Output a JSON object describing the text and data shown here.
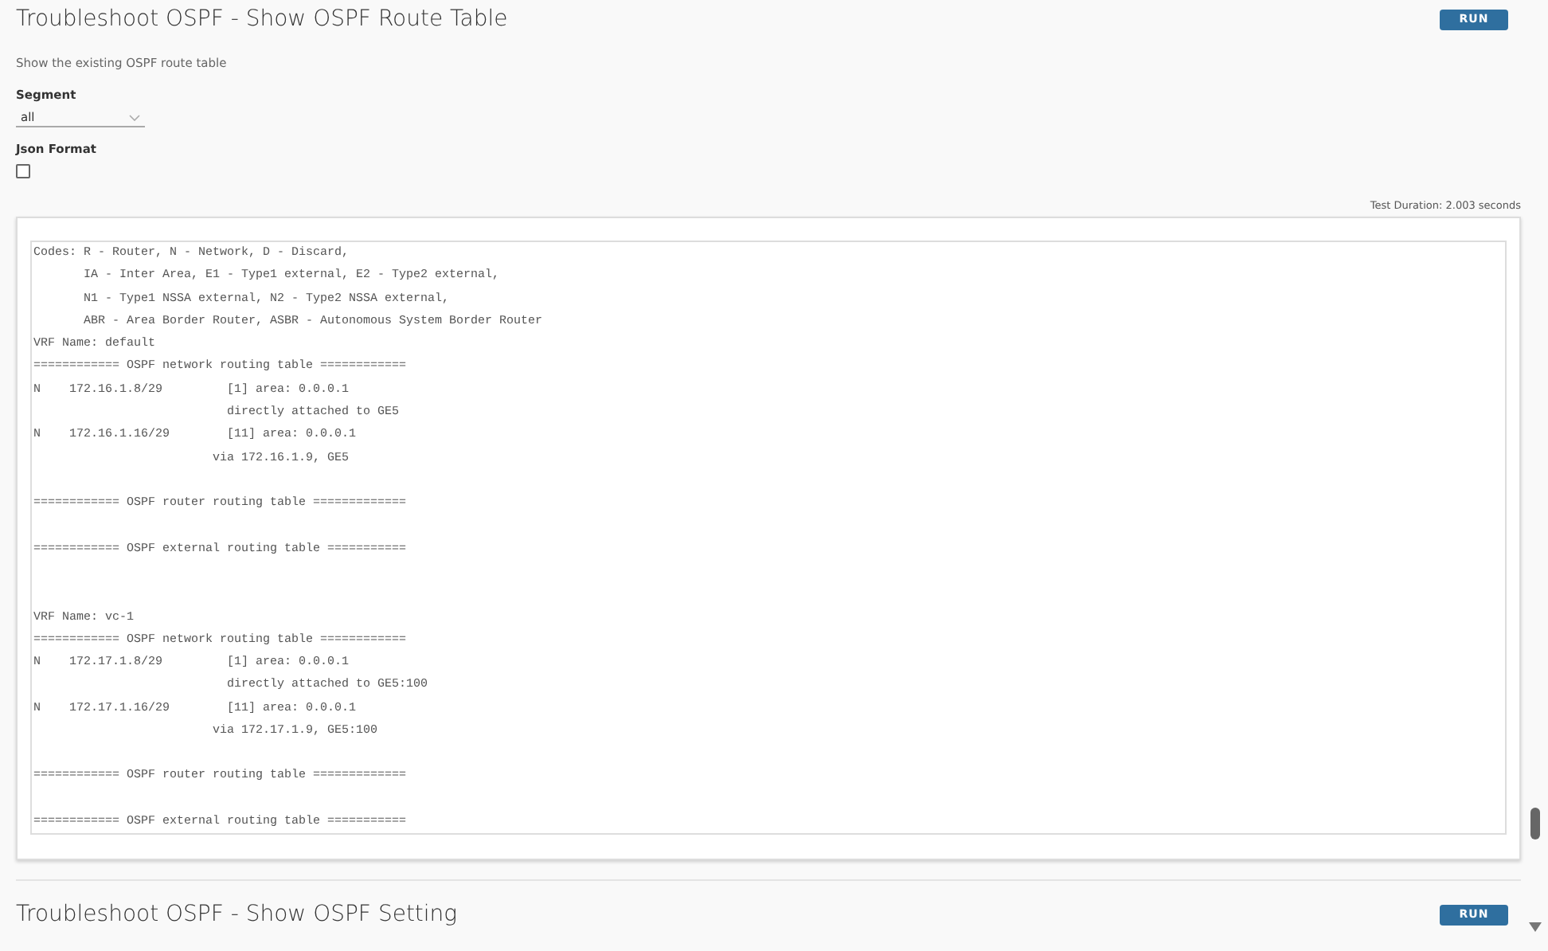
{
  "sections": [
    {
      "title": "Troubleshoot OSPF - Show OSPF Route Table",
      "run_button": "RUN",
      "description": "Show the existing OSPF route table",
      "fields": [
        {
          "kind": "select",
          "label": "Segment",
          "value": "all"
        },
        {
          "kind": "checkbox",
          "label": "Json Format",
          "checked": false
        }
      ],
      "test_duration": "Test Duration: 2.003 seconds",
      "output": "Codes: R - Router, N - Network, D - Discard,\n       IA - Inter Area, E1 - Type1 external, E2 - Type2 external,\n       N1 - Type1 NSSA external, N2 - Type2 NSSA external,\n       ABR - Area Border Router, ASBR - Autonomous System Border Router\nVRF Name: default\n============ OSPF network routing table ============\nN    172.16.1.8/29         [1] area: 0.0.0.1\n                           directly attached to GE5\nN    172.16.1.16/29        [11] area: 0.0.0.1\n                         via 172.16.1.9, GE5\n\n============ OSPF router routing table =============\n\n============ OSPF external routing table ===========\n\n\nVRF Name: vc-1\n============ OSPF network routing table ============\nN    172.17.1.8/29         [1] area: 0.0.0.1\n                           directly attached to GE5:100\nN    172.17.1.16/29        [11] area: 0.0.0.1\n                         via 172.17.1.9, GE5:100\n\n============ OSPF router routing table =============\n\n============ OSPF external routing table ==========="
    },
    {
      "title": "Troubleshoot OSPF - Show OSPF Setting",
      "run_button": "RUN"
    }
  ]
}
